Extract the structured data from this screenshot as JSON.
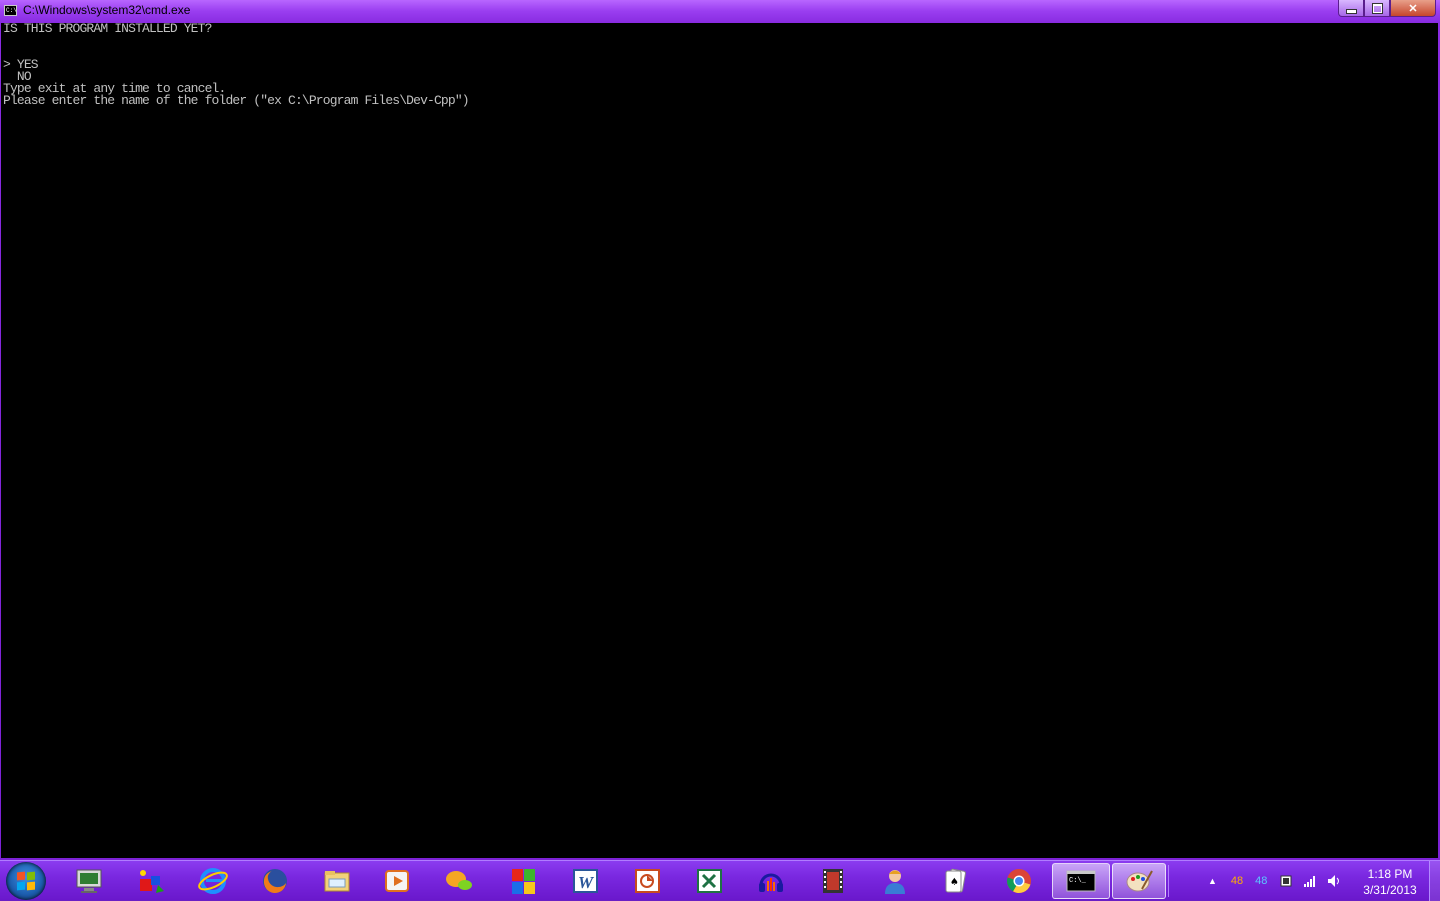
{
  "window": {
    "title": "C:\\Windows\\system32\\cmd.exe",
    "icon_text": "C:\\",
    "controls": {
      "minimize": "minimize-icon",
      "maximize": "restore-icon",
      "close": "✕"
    }
  },
  "console": {
    "lines": [
      "IS THIS PROGRAM INSTALLED YET?",
      "",
      "",
      "> YES",
      "  NO",
      "Type exit at any time to cancel.",
      "Please enter the name of the folder (\"ex C:\\Program Files\\Dev-Cpp\")"
    ]
  },
  "taskbar": {
    "pinned": [
      "start-orb",
      "remote-desktop-icon",
      "paint-shapes-icon",
      "internet-explorer-icon",
      "firefox-icon",
      "file-explorer-icon",
      "media-player-icon",
      "joinme-icon",
      "windows-flag-app-icon",
      "word-icon",
      "powerpoint-icon",
      "excel-icon",
      "audacity-icon",
      "movie-maker-icon",
      "user-account-icon",
      "solitaire-icon",
      "chrome-icon",
      "cmd-icon",
      "paint-icon"
    ],
    "tray": {
      "temp1": "48",
      "temp2": "48",
      "temp1_color": "#ffb000",
      "temp2_color": "#5ac8ff"
    },
    "clock": {
      "time": "1:18 PM",
      "date": "3/31/2013"
    }
  }
}
